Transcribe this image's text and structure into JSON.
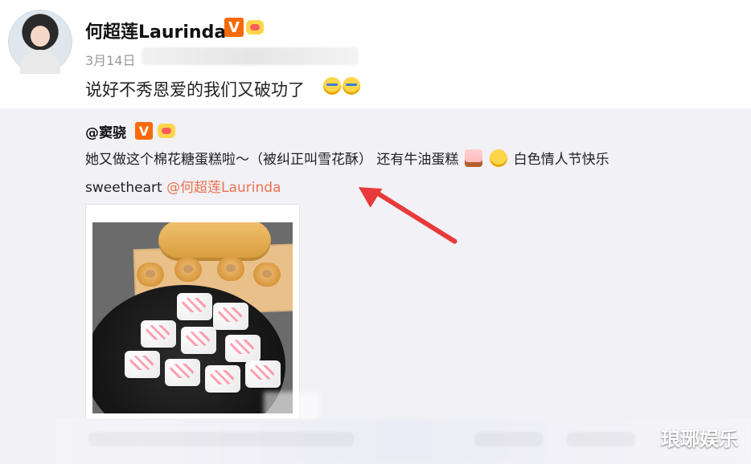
{
  "post": {
    "author": {
      "name": "何超莲Laurinda"
    },
    "date": "3月14日",
    "text": "说好不秀恩爱的我们又破功了"
  },
  "repost": {
    "author": {
      "handle": "@窦骁"
    },
    "text_prefix": "她又做这个棉花糖蛋糕啦～（被纠正叫雪花酥） 还有牛油蛋糕",
    "text_suffix": " 白色情人节快乐",
    "text_line2": "sweetheart",
    "mention": "@何超莲Laurinda"
  },
  "watermark": {
    "text": "琅琊娱乐"
  },
  "icons": {
    "verified": "verified-badge-icon",
    "crown": "crown-icon",
    "emoji_cry": "laugh-cry-emoji-icon",
    "emoji_cake": "cake-emoji-icon",
    "emoji_blush": "blush-emoji-icon",
    "annotation_arrow": "red-arrow-annotation-icon"
  },
  "colors": {
    "link": "#eb7350",
    "verified_badge": "#f66a0a",
    "repost_background": "#f1f1f6",
    "annotation_arrow": "#e83a3a"
  }
}
